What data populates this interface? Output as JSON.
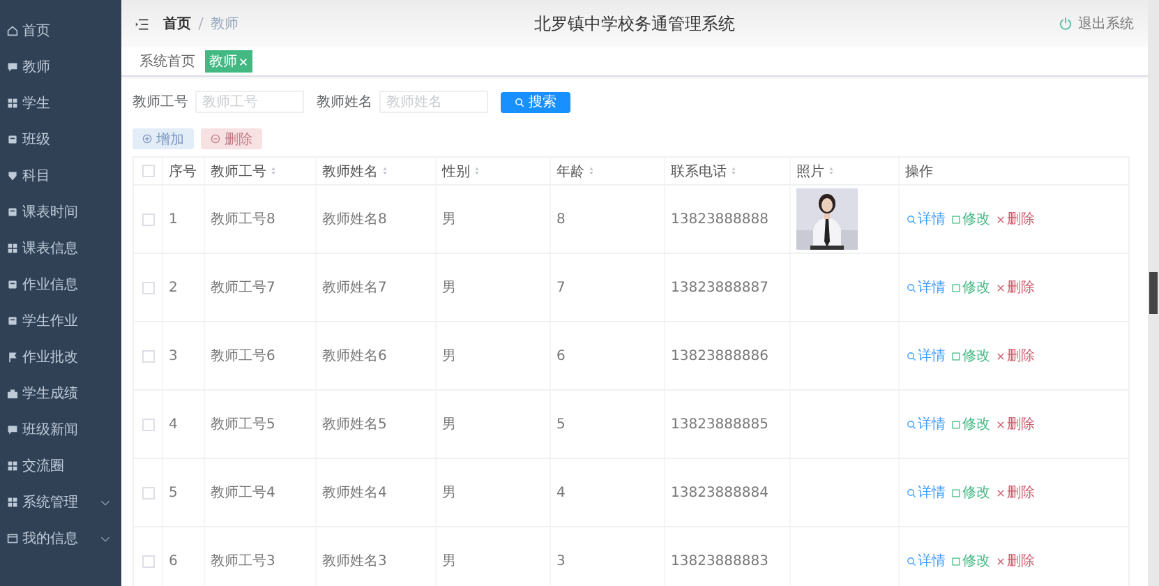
{
  "sidebar": {
    "items": [
      {
        "label": "首页",
        "kind": "link"
      },
      {
        "label": "教师",
        "kind": "link"
      },
      {
        "label": "学生",
        "kind": "link"
      },
      {
        "label": "班级",
        "kind": "link"
      },
      {
        "label": "科目",
        "kind": "link"
      },
      {
        "label": "课表时间",
        "kind": "link"
      },
      {
        "label": "课表信息",
        "kind": "link"
      },
      {
        "label": "作业信息",
        "kind": "link"
      },
      {
        "label": "学生作业",
        "kind": "link"
      },
      {
        "label": "作业批改",
        "kind": "link"
      },
      {
        "label": "学生成绩",
        "kind": "link"
      },
      {
        "label": "班级新闻",
        "kind": "link"
      },
      {
        "label": "交流圈",
        "kind": "link"
      },
      {
        "label": "系统管理",
        "kind": "group",
        "expanded": false
      },
      {
        "label": "我的信息",
        "kind": "group",
        "expanded": false
      }
    ]
  },
  "header": {
    "breadcrumb": [
      "首页",
      "教师"
    ],
    "title": "北罗镇中学校务通管理系统",
    "logout": "退出系统"
  },
  "tabs": [
    {
      "label": "系统首页",
      "selected": false,
      "closable": false
    },
    {
      "label": "教师",
      "selected": true,
      "closable": true
    }
  ],
  "search": {
    "fields": [
      {
        "label": "教师工号",
        "placeholder": "教师工号"
      },
      {
        "label": "教师姓名",
        "placeholder": "教师姓名"
      }
    ],
    "button": "搜索"
  },
  "actions": [
    {
      "label": "增加",
      "kind": "add"
    },
    {
      "label": "删除",
      "kind": "delete"
    }
  ],
  "table": {
    "select_all": {
      "checked": false
    },
    "columns": [
      {
        "label": "序号",
        "sortable": false
      },
      {
        "label": "教师工号",
        "sortable": true
      },
      {
        "label": "教师姓名",
        "sortable": true
      },
      {
        "label": "性别",
        "sortable": true
      },
      {
        "label": "年龄",
        "sortable": true
      },
      {
        "label": "联系电话",
        "sortable": true
      },
      {
        "label": "照片",
        "sortable": true
      },
      {
        "label": "操作",
        "sortable": false
      }
    ],
    "rows": [
      {
        "checked": false,
        "no": "1",
        "id": "教师工号8",
        "name": "教师姓名8",
        "gender": "男",
        "age": "8",
        "phone": "13823888888",
        "actions": [
          {
            "label": "详情",
            "kind": "view"
          },
          {
            "label": "修改",
            "kind": "edit"
          },
          {
            "label": "删除",
            "kind": "delete"
          }
        ]
      },
      {
        "checked": false,
        "no": "2",
        "id": "教师工号7",
        "name": "教师姓名7",
        "gender": "男",
        "age": "7",
        "phone": "13823888887",
        "actions": [
          {
            "label": "详情",
            "kind": "view"
          },
          {
            "label": "修改",
            "kind": "edit"
          },
          {
            "label": "删除",
            "kind": "delete"
          }
        ]
      },
      {
        "checked": false,
        "no": "3",
        "id": "教师工号6",
        "name": "教师姓名6",
        "gender": "男",
        "age": "6",
        "phone": "13823888886",
        "actions": [
          {
            "label": "详情",
            "kind": "view"
          },
          {
            "label": "修改",
            "kind": "edit"
          },
          {
            "label": "删除",
            "kind": "delete"
          }
        ]
      },
      {
        "checked": false,
        "no": "4",
        "id": "教师工号5",
        "name": "教师姓名5",
        "gender": "男",
        "age": "5",
        "phone": "13823888885",
        "actions": [
          {
            "label": "详情",
            "kind": "view"
          },
          {
            "label": "修改",
            "kind": "edit"
          },
          {
            "label": "删除",
            "kind": "delete"
          }
        ]
      },
      {
        "checked": false,
        "no": "5",
        "id": "教师工号4",
        "name": "教师姓名4",
        "gender": "男",
        "age": "4",
        "phone": "13823888884",
        "actions": [
          {
            "label": "详情",
            "kind": "view"
          },
          {
            "label": "修改",
            "kind": "edit"
          },
          {
            "label": "删除",
            "kind": "delete"
          }
        ]
      },
      {
        "checked": false,
        "no": "6",
        "id": "教师工号3",
        "name": "教师姓名3",
        "gender": "男",
        "age": "3",
        "phone": "13823888883",
        "actions": [
          {
            "label": "详情",
            "kind": "view"
          },
          {
            "label": "修改",
            "kind": "edit"
          },
          {
            "label": "删除",
            "kind": "delete"
          }
        ]
      }
    ]
  }
}
